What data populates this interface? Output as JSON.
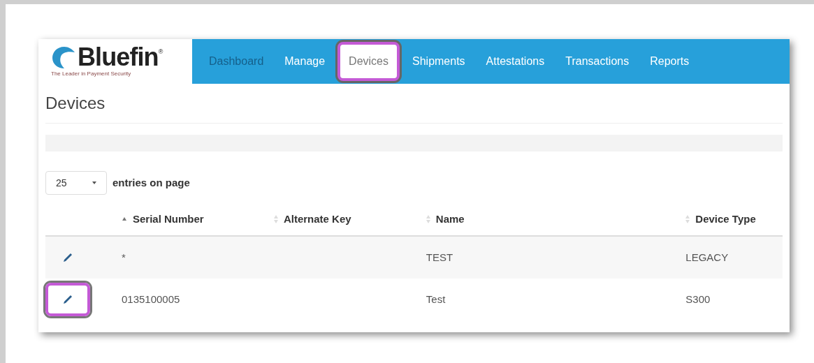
{
  "logo": {
    "name": "Bluefin",
    "mark": "®",
    "tagline": "The Leader in Payment Security"
  },
  "nav": [
    {
      "label": "Dashboard",
      "selected": false,
      "disabled": true,
      "highlighted": false
    },
    {
      "label": "Manage",
      "selected": false,
      "disabled": false,
      "highlighted": false
    },
    {
      "label": "Devices",
      "selected": true,
      "disabled": false,
      "highlighted": true
    },
    {
      "label": "Shipments",
      "selected": false,
      "disabled": false,
      "highlighted": false
    },
    {
      "label": "Attestations",
      "selected": false,
      "disabled": false,
      "highlighted": false
    },
    {
      "label": "Transactions",
      "selected": false,
      "disabled": false,
      "highlighted": false
    },
    {
      "label": "Reports",
      "selected": false,
      "disabled": false,
      "highlighted": false
    }
  ],
  "page_title": "Devices",
  "page_size": {
    "value": "25",
    "label": "entries on page"
  },
  "table": {
    "columns": [
      {
        "label": "Serial Number",
        "sorted": true
      },
      {
        "label": "Alternate Key",
        "sorted": false
      },
      {
        "label": "Name",
        "sorted": false
      },
      {
        "label": "Device Type",
        "sorted": false
      }
    ],
    "rows": [
      {
        "serial_number": "*",
        "name": "TEST",
        "device_type": "LEGACY",
        "highlighted": false
      },
      {
        "serial_number": "0135100005",
        "name": "Test",
        "device_type": "S300",
        "highlighted": true
      }
    ]
  }
}
